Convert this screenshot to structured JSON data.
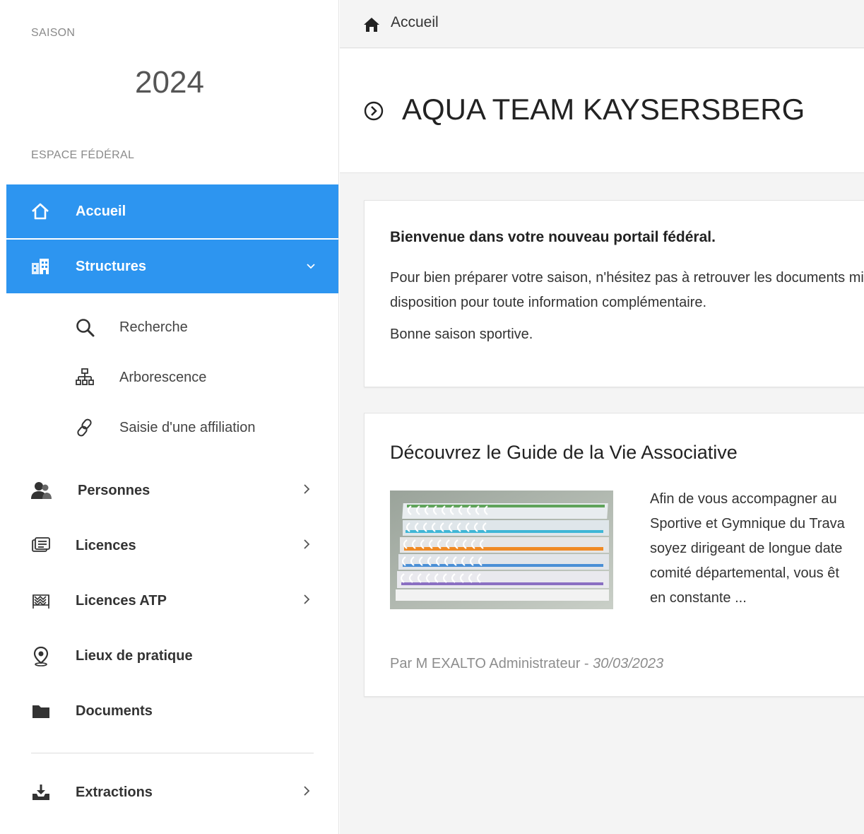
{
  "sidebar": {
    "season_label": "SAISON",
    "season_year": "2024",
    "section_label": "ESPACE FÉDÉRAL",
    "items": [
      {
        "label": "Accueil",
        "icon": "home-icon",
        "active": true
      },
      {
        "label": "Structures",
        "icon": "structures-icon",
        "active": true,
        "expanded": true,
        "children": [
          {
            "label": "Recherche",
            "icon": "search-icon"
          },
          {
            "label": "Arborescence",
            "icon": "tree-icon"
          },
          {
            "label": "Saisie d'une affiliation",
            "icon": "link-icon"
          }
        ]
      },
      {
        "label": "Personnes",
        "icon": "users-icon"
      },
      {
        "label": "Licences",
        "icon": "license-card-icon"
      },
      {
        "label": "Licences ATP",
        "icon": "atp-icon"
      },
      {
        "label": "Lieux de pratique",
        "icon": "location-pin-icon"
      },
      {
        "label": "Documents",
        "icon": "folder-icon"
      },
      {
        "label": "Extractions",
        "icon": "download-tray-icon"
      }
    ]
  },
  "header": {
    "breadcrumb": "Accueil"
  },
  "page": {
    "title": "AQUA TEAM KAYSERSBERG"
  },
  "welcome": {
    "title": "Bienvenue dans votre nouveau portail fédéral.",
    "paragraph": "Pour bien préparer votre saison, n'hésitez pas à retrouver les documents mis à votre disposition pour toute information complémentaire.",
    "closing": "Bonne saison sportive."
  },
  "guide": {
    "title": "Découvrez le Guide de la Vie Associative",
    "text_lines": [
      "Afin de vous accompagner au",
      "Sportive et Gymnique du Trava",
      "soyez dirigeant de longue date",
      "comité départemental, vous êt",
      "en constante ..."
    ],
    "author": "Par M EXALTO Administrateur - ",
    "date": "30/03/2023"
  },
  "colors": {
    "accent": "#2d95f0",
    "background": "#f4f4f4"
  }
}
